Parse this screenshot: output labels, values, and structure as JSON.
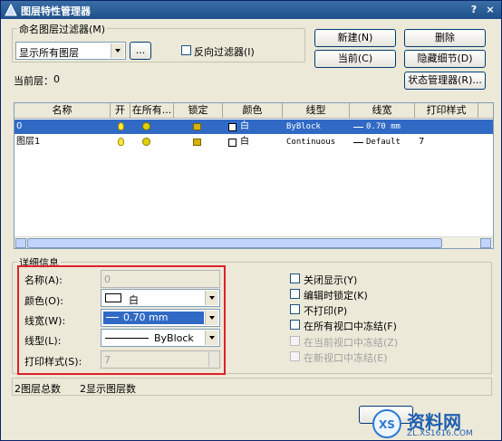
{
  "window": {
    "title": "图层特性管理器",
    "help": "?",
    "close": "×"
  },
  "filter": {
    "group_label": "命名图层过滤器(M)",
    "selected": "显示所有图层",
    "browse_label": "...",
    "invert_label": "反向过滤器(I)"
  },
  "buttons": {
    "new": "新建(N)",
    "delete": "删除",
    "current": "当前(C)",
    "hide_details": "隐藏细节(D)",
    "state_manager": "状态管理器(R)..."
  },
  "current_layer": {
    "label": "当前层：",
    "value": "0"
  },
  "table": {
    "headers": [
      "名称",
      "开",
      "在所有...",
      "锁定",
      "颜色",
      "线型",
      "线宽",
      "打印样式"
    ],
    "rows": [
      {
        "name": "0",
        "color": "白",
        "linetype": "ByBlock",
        "lineweight": "0.70 mm",
        "plotstyle": ""
      },
      {
        "name": "图层1",
        "color": "白",
        "linetype": "Continuous",
        "lineweight": "Default",
        "plotstyle": "7"
      }
    ]
  },
  "details": {
    "group_label": "详细信息",
    "name_label": "名称(A):",
    "name_value": "0",
    "color_label": "颜色(O):",
    "color_value": "白",
    "lineweight_label": "线宽(W):",
    "lineweight_value": "0.70 mm",
    "linetype_label": "线型(L):",
    "linetype_value": "ByBlock",
    "plotstyle_label": "打印样式(S):",
    "plotstyle_value": "7",
    "checks": [
      {
        "label": "关闭显示(Y)",
        "enabled": true
      },
      {
        "label": "编辑时锁定(K)",
        "enabled": true
      },
      {
        "label": "不打印(P)",
        "enabled": true
      },
      {
        "label": "在所有视口中冻结(F)",
        "enabled": true
      },
      {
        "label": "在当前视口中冻结(Z)",
        "enabled": false
      },
      {
        "label": "在新视口中冻结(E)",
        "enabled": false
      }
    ]
  },
  "status": {
    "total": "2图层总数",
    "shown": "2显示图层数"
  },
  "watermark": {
    "text": "资料网",
    "url": "ZL.XS1616.COM"
  },
  "colors": {
    "selection": "#316ac5",
    "highlight": "#e0202a"
  }
}
